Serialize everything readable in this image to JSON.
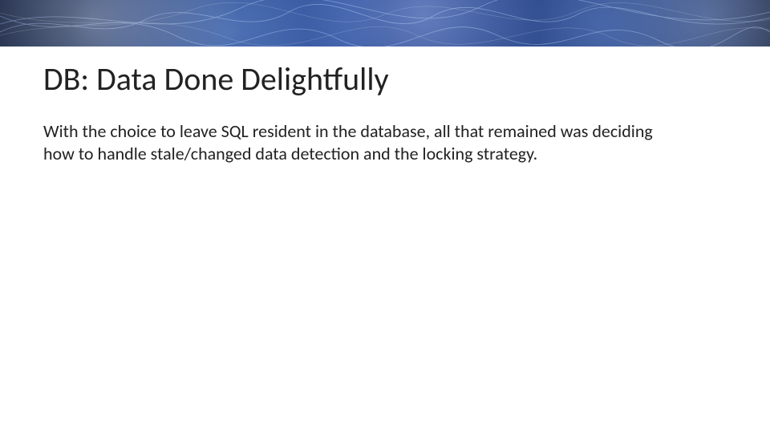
{
  "slide": {
    "title": "DB: Data Done Delightfully",
    "body": "With the choice to leave SQL resident in the database, all that remained was deciding how to handle stale/changed data detection and the locking strategy."
  }
}
